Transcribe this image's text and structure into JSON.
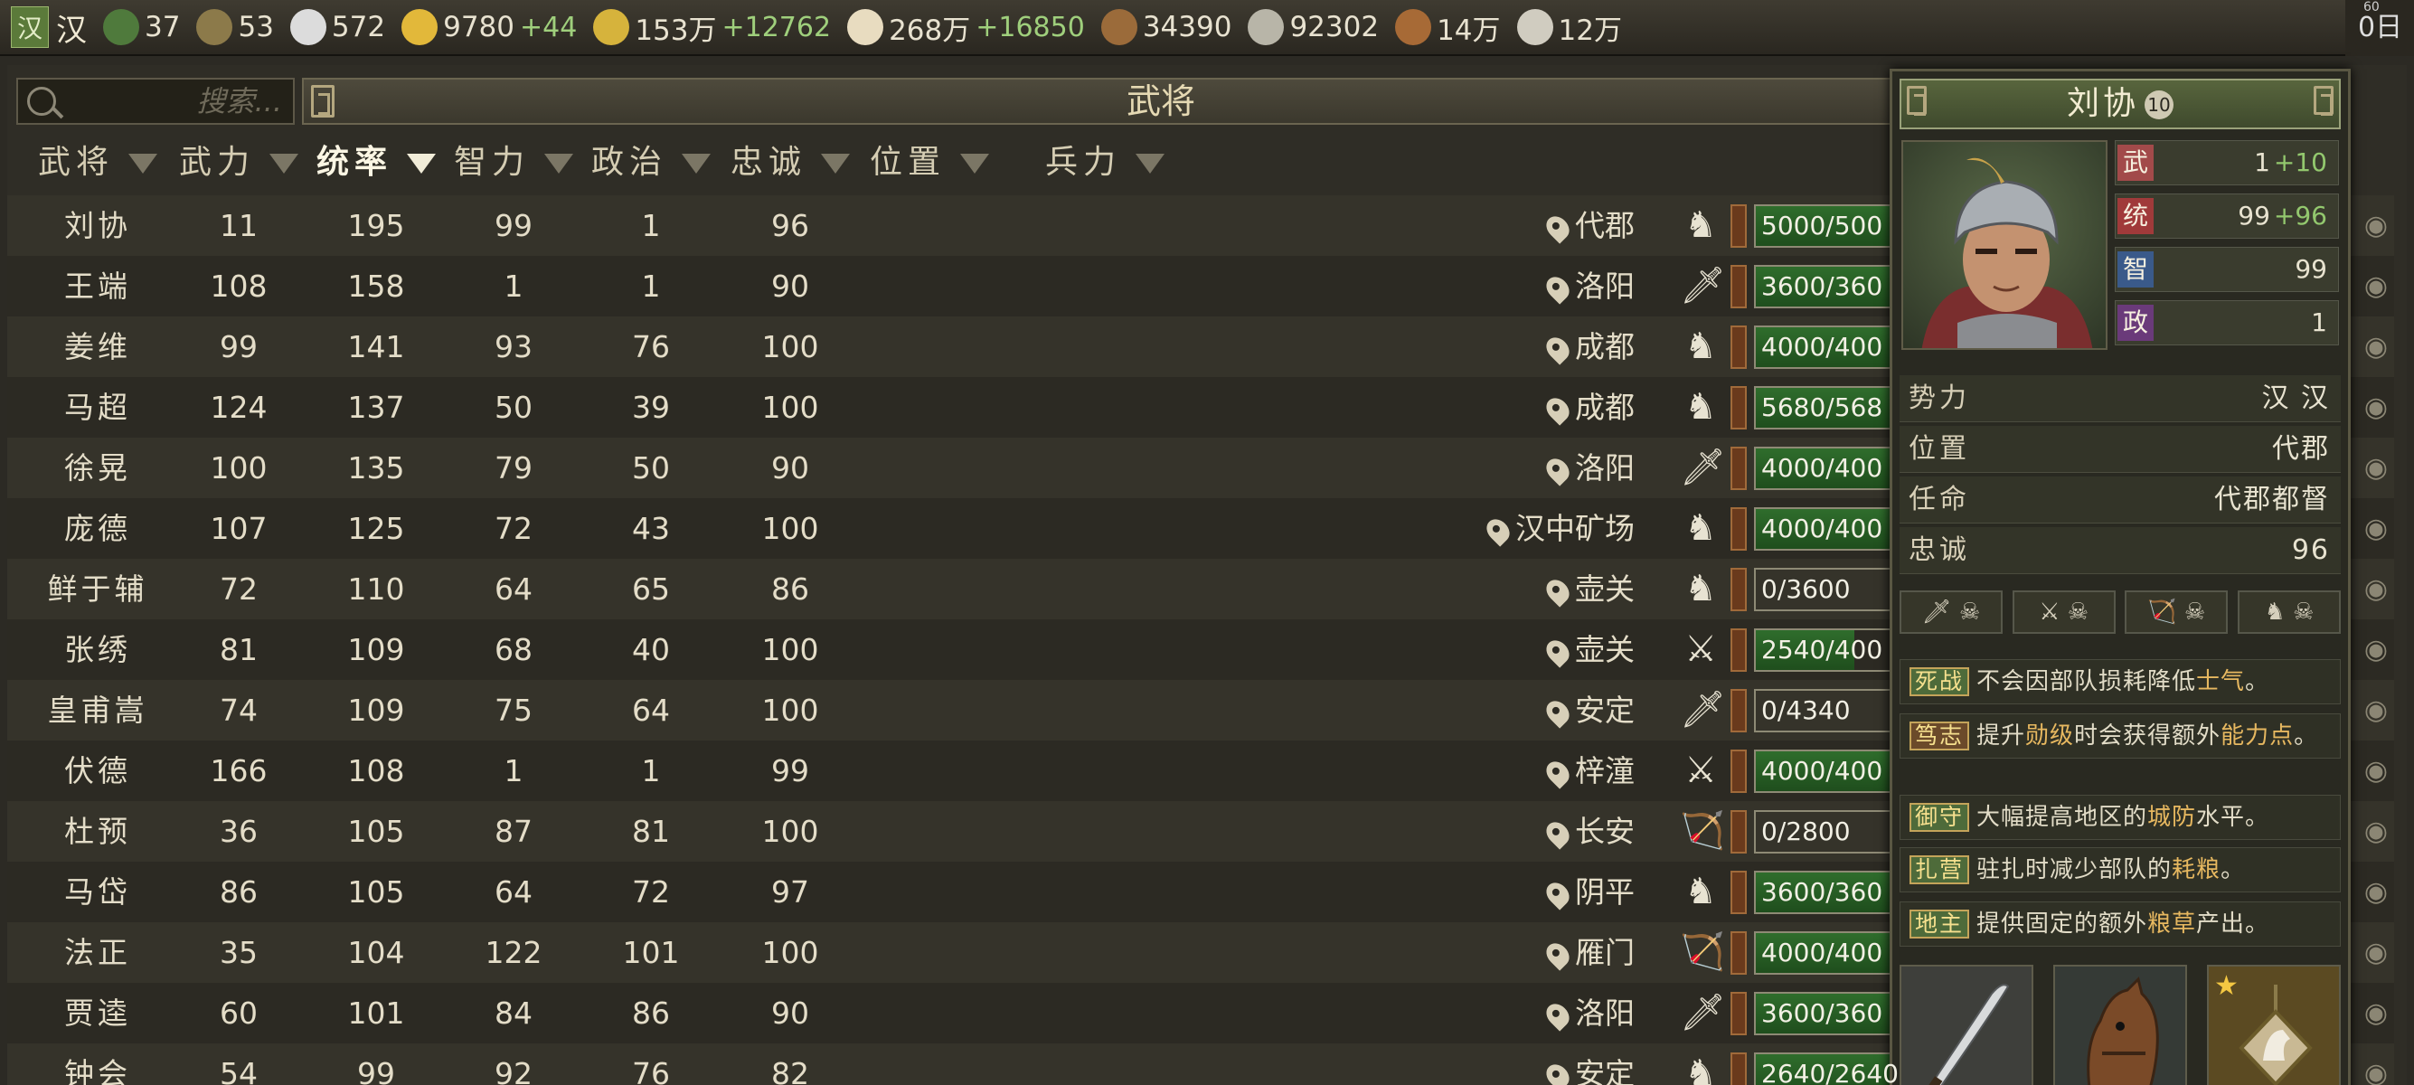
{
  "topbar": {
    "faction_badge": "汉",
    "faction_name": "汉",
    "resources": [
      {
        "icon": "city-icon",
        "color": "#4f7a3c",
        "value": "37",
        "delta": ""
      },
      {
        "icon": "officer-icon",
        "color": "#8c7a4a",
        "value": "53",
        "delta": ""
      },
      {
        "icon": "yinyang-icon",
        "color": "#dcdcdc",
        "value": "572",
        "delta": ""
      },
      {
        "icon": "crown-icon",
        "color": "#e2b83a",
        "value": "9780",
        "delta": "+44"
      },
      {
        "icon": "coin-icon",
        "color": "#d6b33c",
        "value": "153万",
        "delta": "+12762"
      },
      {
        "icon": "rice-icon",
        "color": "#e8dcc0",
        "value": "268万",
        "delta": "+16850"
      },
      {
        "icon": "wood-icon",
        "color": "#9b6b3a",
        "value": "34390",
        "delta": ""
      },
      {
        "icon": "stone-icon",
        "color": "#b8b5a8",
        "value": "92302",
        "delta": ""
      },
      {
        "icon": "horse-icon",
        "color": "#a76a36",
        "value": "14万",
        "delta": ""
      },
      {
        "icon": "iron-icon",
        "color": "#d0ccc0",
        "value": "12万",
        "delta": ""
      }
    ],
    "date": "0日",
    "fps": "60"
  },
  "search": {
    "placeholder": "搜索..."
  },
  "title": "武将",
  "columns": [
    {
      "label": "武将",
      "active": false
    },
    {
      "label": "武力",
      "active": false
    },
    {
      "label": "统率",
      "active": true
    },
    {
      "label": "智力",
      "active": false
    },
    {
      "label": "政治",
      "active": false
    },
    {
      "label": "忠诚",
      "active": false
    },
    {
      "label": "位置",
      "active": false
    },
    {
      "label": "兵力",
      "active": false
    }
  ],
  "rows": [
    {
      "name": "刘协",
      "war": "11",
      "lead": "195",
      "int": "99",
      "pol": "1",
      "loyal": "96",
      "loc": "代郡",
      "unit": "cavalry-icon",
      "troops": "5000/500",
      "fill": 1.0
    },
    {
      "name": "王端",
      "war": "108",
      "lead": "158",
      "int": "1",
      "pol": "1",
      "loyal": "90",
      "loc": "洛阳",
      "unit": "sword-icon",
      "troops": "3600/360",
      "fill": 1.0
    },
    {
      "name": "姜维",
      "war": "99",
      "lead": "141",
      "int": "93",
      "pol": "76",
      "loyal": "100",
      "loc": "成都",
      "unit": "cavalry-icon",
      "troops": "4000/400",
      "fill": 1.0
    },
    {
      "name": "马超",
      "war": "124",
      "lead": "137",
      "int": "50",
      "pol": "39",
      "loyal": "100",
      "loc": "成都",
      "unit": "cavalry-icon",
      "troops": "5680/568",
      "fill": 1.0
    },
    {
      "name": "徐晃",
      "war": "100",
      "lead": "135",
      "int": "79",
      "pol": "50",
      "loyal": "90",
      "loc": "洛阳",
      "unit": "sword-icon",
      "troops": "4000/400",
      "fill": 1.0
    },
    {
      "name": "庞德",
      "war": "107",
      "lead": "125",
      "int": "72",
      "pol": "43",
      "loyal": "100",
      "loc": "汉中矿场",
      "unit": "cavalry-icon",
      "troops": "4000/400",
      "fill": 1.0
    },
    {
      "name": "鲜于辅",
      "war": "72",
      "lead": "110",
      "int": "64",
      "pol": "65",
      "loyal": "86",
      "loc": "壶关",
      "unit": "cavalry-icon",
      "troops": "0/3600",
      "fill": 0.0
    },
    {
      "name": "张绣",
      "war": "81",
      "lead": "109",
      "int": "68",
      "pol": "40",
      "loyal": "100",
      "loc": "壶关",
      "unit": "spear-icon",
      "troops": "2540/400",
      "fill": 0.64
    },
    {
      "name": "皇甫嵩",
      "war": "74",
      "lead": "109",
      "int": "75",
      "pol": "64",
      "loyal": "100",
      "loc": "安定",
      "unit": "sword-icon",
      "troops": "0/4340",
      "fill": 0.0
    },
    {
      "name": "伏德",
      "war": "166",
      "lead": "108",
      "int": "1",
      "pol": "1",
      "loyal": "99",
      "loc": "梓潼",
      "unit": "spear-icon",
      "troops": "4000/400",
      "fill": 1.0
    },
    {
      "name": "杜预",
      "war": "36",
      "lead": "105",
      "int": "87",
      "pol": "81",
      "loyal": "100",
      "loc": "长安",
      "unit": "bow-icon",
      "troops": "0/2800",
      "fill": 0.0
    },
    {
      "name": "马岱",
      "war": "86",
      "lead": "105",
      "int": "64",
      "pol": "72",
      "loyal": "97",
      "loc": "阴平",
      "unit": "cavalry-icon",
      "troops": "3600/360",
      "fill": 1.0
    },
    {
      "name": "法正",
      "war": "35",
      "lead": "104",
      "int": "122",
      "pol": "101",
      "loyal": "100",
      "loc": "雁门",
      "unit": "bow-icon",
      "troops": "4000/400",
      "fill": 1.0
    },
    {
      "name": "贾逵",
      "war": "60",
      "lead": "101",
      "int": "84",
      "pol": "86",
      "loyal": "90",
      "loc": "洛阳",
      "unit": "sword-icon",
      "troops": "3600/360",
      "fill": 1.0
    },
    {
      "name": "钟会",
      "war": "54",
      "lead": "99",
      "int": "92",
      "pol": "76",
      "loyal": "82",
      "loc": "安定",
      "unit": "cavalry-icon",
      "troops": "2640/2640",
      "fill": 1.0
    }
  ],
  "panel": {
    "name": "刘协",
    "level": "10",
    "stats": [
      {
        "label": "武",
        "color": "#a24a4a",
        "value": "1",
        "bonus": "+10"
      },
      {
        "label": "统",
        "color": "#a03a3a",
        "value": "99",
        "bonus": "+96"
      },
      {
        "label": "智",
        "color": "#3a5a8a",
        "value": "99",
        "bonus": ""
      },
      {
        "label": "政",
        "color": "#6a3a7a",
        "value": "1",
        "bonus": ""
      }
    ],
    "info": [
      {
        "label": "势力",
        "value": "汉 汉"
      },
      {
        "label": "位置",
        "value": "代郡"
      },
      {
        "label": "任命",
        "value": "代郡都督"
      },
      {
        "label": "忠诚",
        "value": "96"
      }
    ],
    "trait_slots": [
      "sword-icon",
      "spear-icon",
      "bow-icon",
      "cavalry-icon"
    ],
    "skills": [
      {
        "tag": "死战",
        "text_a": "不会因部队损耗降低",
        "hl": "士气",
        "text_b": "。"
      },
      {
        "tag": "笃志",
        "text_a": "提升",
        "hl": "勋级",
        "text_b": "时会获得额外",
        "hl2": "能力点",
        "text_c": "。"
      },
      {
        "tag": "御守",
        "text_a": "大幅提高地区的",
        "hl": "城防",
        "text_b": "水平。"
      },
      {
        "tag": "扎营",
        "text_a": "驻扎",
        "text_b": "时减少部队的",
        "hl": "耗粮",
        "text_c": "。"
      },
      {
        "tag": "地主",
        "text_a": "提供固定的额外",
        "hl": "粮草",
        "text_b": "产出。"
      }
    ],
    "equipment": [
      "blade-icon",
      "horse-icon",
      "token-icon"
    ]
  }
}
